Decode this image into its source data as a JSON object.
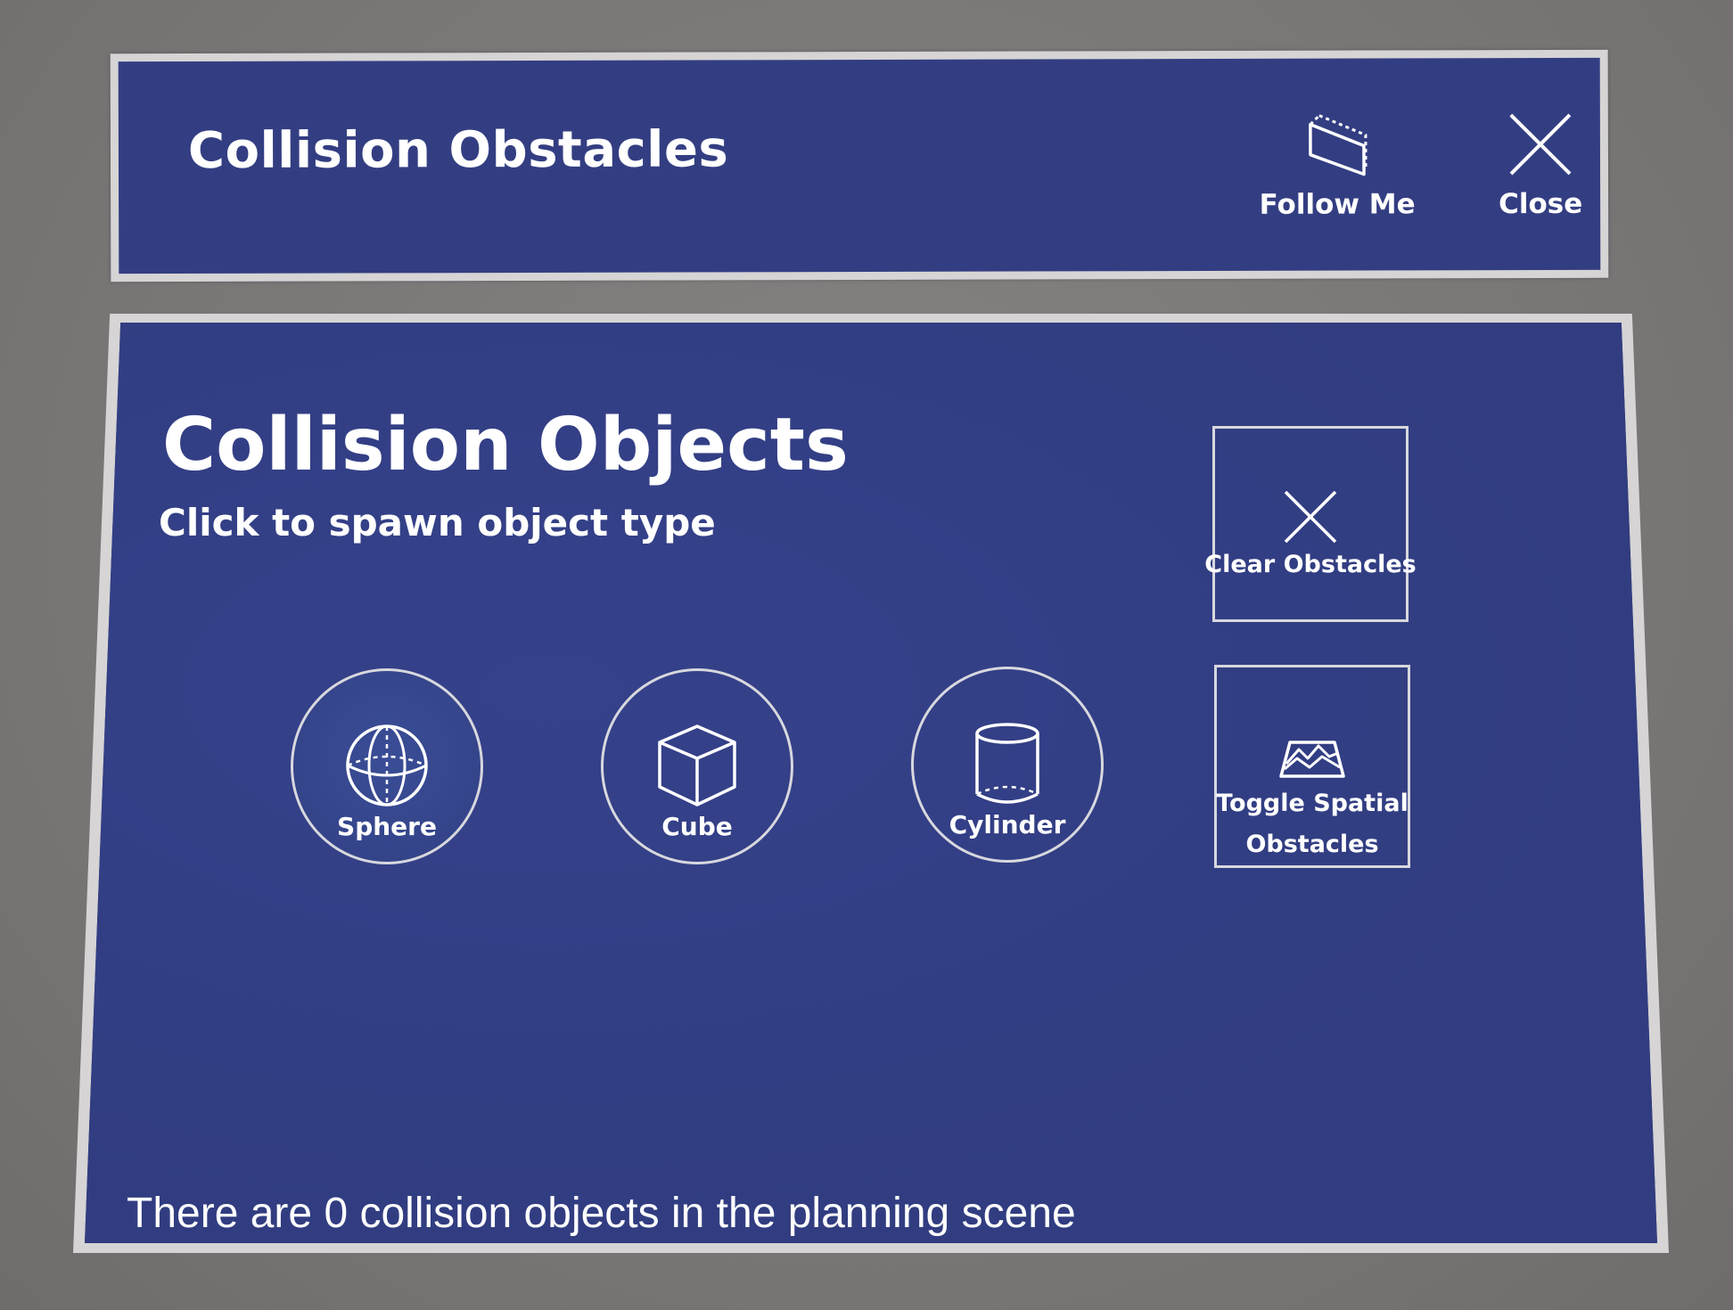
{
  "header": {
    "title": "Collision Obstacles",
    "follow_me_label": "Follow Me",
    "close_label": "Close"
  },
  "main": {
    "title": "Collision Objects",
    "subtitle": "Click to spawn object type",
    "spawn_buttons": [
      {
        "label": "Sphere",
        "icon": "sphere-icon"
      },
      {
        "label": "Cube",
        "icon": "cube-icon"
      },
      {
        "label": "Cylinder",
        "icon": "cylinder-icon"
      }
    ],
    "clear_label": "Clear Obstacles",
    "toggle_label_line1": "Toggle Spatial",
    "toggle_label_line2": "Obstacles",
    "status": "There are 0 collision objects in the planning scene"
  },
  "colors": {
    "panel_bg": "#333e82",
    "panel_border": "#d6d4d4",
    "background": "#7d7a79",
    "text": "#ffffff"
  }
}
